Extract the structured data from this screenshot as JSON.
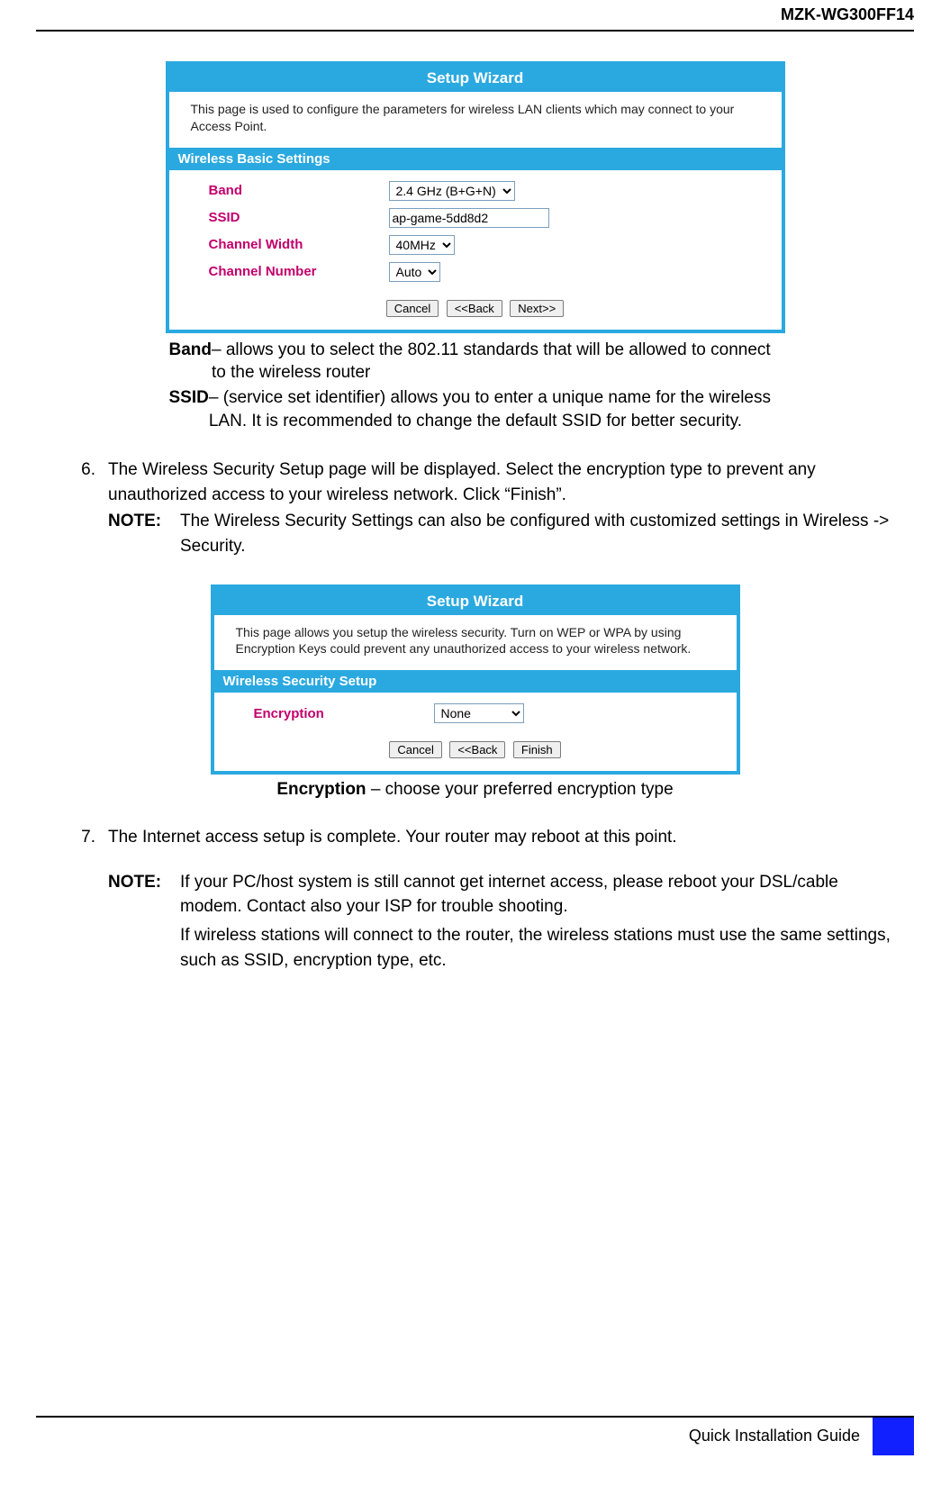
{
  "header": {
    "model": "MZK-WG300FF14"
  },
  "wizard1": {
    "title": "Setup Wizard",
    "desc": "This page is used to configure the parameters for wireless LAN clients which may connect to your Access Point.",
    "section": "Wireless Basic Settings",
    "fields": {
      "band_label": "Band",
      "band_value": "2.4 GHz (B+G+N)",
      "ssid_label": "SSID",
      "ssid_value": "ap-game-5dd8d2",
      "chwidth_label": "Channel Width",
      "chwidth_value": "40MHz",
      "chnum_label": "Channel Number",
      "chnum_value": "Auto"
    },
    "buttons": {
      "cancel": "Cancel",
      "back": "<<Back",
      "next": "Next>>"
    }
  },
  "defs1": {
    "band_k": "Band",
    "band_v": " – allows you to select the 802.11 standards that will be allowed to connect to the wireless router",
    "ssid_k": "SSID",
    "ssid_v": " – (service set identifier) allows you to enter a unique name for the wireless LAN. It is recommended to change the default SSID for better security."
  },
  "step6": {
    "num": "6.",
    "text": "The Wireless Security Setup page will be displayed. Select the encryption type to prevent any unauthorized access to your wireless network. Click “Finish”.",
    "note_label": "NOTE:",
    "note_text": "The Wireless Security Settings can also be configured with customized settings in Wireless -> Security."
  },
  "wizard2": {
    "title": "Setup Wizard",
    "desc": "This page allows you setup the wireless security. Turn on WEP or WPA by using Encryption Keys could prevent any unauthorized access to your wireless network.",
    "section": "Wireless Security Setup",
    "fields": {
      "enc_label": "Encryption",
      "enc_value": "None"
    },
    "buttons": {
      "cancel": "Cancel",
      "back": "<<Back",
      "finish": "Finish"
    }
  },
  "caption2": {
    "k": "Encryption",
    "v": " – choose your preferred encryption type"
  },
  "step7": {
    "num": "7.",
    "text": "The Internet access setup is complete. Your router may reboot at this point.",
    "note_label": "NOTE:",
    "note_text1": "If your PC/host system is still cannot get internet access, please reboot your DSL/cable modem. Contact also your ISP for trouble shooting.",
    "note_text2": "If wireless stations will connect to the router, the wireless stations must use the same settings, such as SSID, encryption type, etc."
  },
  "footer": {
    "text": "Quick Installation Guide"
  }
}
